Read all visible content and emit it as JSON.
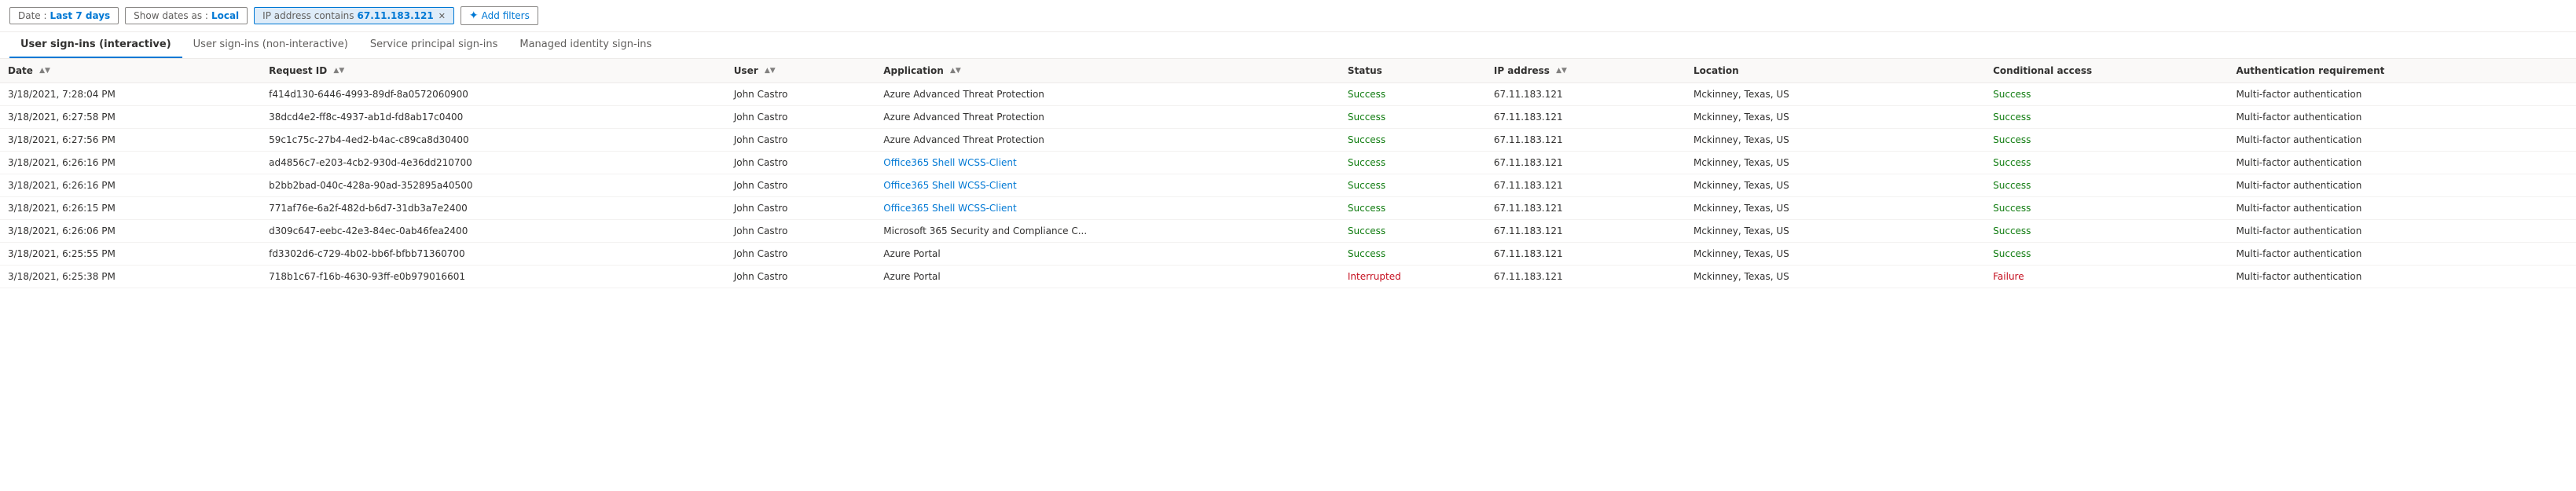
{
  "topbar": {
    "date_label": "Date :",
    "date_value": "Last 7 days",
    "show_dates_label": "Show dates as :",
    "show_dates_value": "Local",
    "ip_filter_label": "IP address contains",
    "ip_filter_value": "67.11.183.121",
    "add_filters_label": "Add filters"
  },
  "tabs": [
    {
      "id": "interactive",
      "label": "User sign-ins (interactive)",
      "active": true
    },
    {
      "id": "noninteractive",
      "label": "User sign-ins (non-interactive)",
      "active": false
    },
    {
      "id": "service",
      "label": "Service principal sign-ins",
      "active": false
    },
    {
      "id": "managed",
      "label": "Managed identity sign-ins",
      "active": false
    }
  ],
  "table": {
    "columns": [
      {
        "id": "date",
        "label": "Date",
        "sortable": true
      },
      {
        "id": "reqid",
        "label": "Request ID",
        "sortable": true
      },
      {
        "id": "user",
        "label": "User",
        "sortable": true
      },
      {
        "id": "app",
        "label": "Application",
        "sortable": true
      },
      {
        "id": "status",
        "label": "Status",
        "sortable": false
      },
      {
        "id": "ip",
        "label": "IP address",
        "sortable": true
      },
      {
        "id": "location",
        "label": "Location",
        "sortable": false
      },
      {
        "id": "ca",
        "label": "Conditional access",
        "sortable": false
      },
      {
        "id": "auth",
        "label": "Authentication requirement",
        "sortable": false
      }
    ],
    "rows": [
      {
        "date": "3/18/2021, 7:28:04 PM",
        "reqid": "f414d130-6446-4993-89df-8a0572060900",
        "user": "John Castro",
        "app": "Azure Advanced Threat Protection",
        "app_link": false,
        "status": "Success",
        "status_type": "success",
        "ip": "67.11.183.121",
        "location": "Mckinney, Texas, US",
        "ca": "Success",
        "auth": "Multi-factor authentication"
      },
      {
        "date": "3/18/2021, 6:27:58 PM",
        "reqid": "38dcd4e2-ff8c-4937-ab1d-fd8ab17c0400",
        "user": "John Castro",
        "app": "Azure Advanced Threat Protection",
        "app_link": false,
        "status": "Success",
        "status_type": "success",
        "ip": "67.11.183.121",
        "location": "Mckinney, Texas, US",
        "ca": "Success",
        "auth": "Multi-factor authentication"
      },
      {
        "date": "3/18/2021, 6:27:56 PM",
        "reqid": "59c1c75c-27b4-4ed2-b4ac-c89ca8d30400",
        "user": "John Castro",
        "app": "Azure Advanced Threat Protection",
        "app_link": false,
        "status": "Success",
        "status_type": "success",
        "ip": "67.11.183.121",
        "location": "Mckinney, Texas, US",
        "ca": "Success",
        "auth": "Multi-factor authentication"
      },
      {
        "date": "3/18/2021, 6:26:16 PM",
        "reqid": "ad4856c7-e203-4cb2-930d-4e36dd210700",
        "user": "John Castro",
        "app": "Office365 Shell WCSS-Client",
        "app_link": true,
        "status": "Success",
        "status_type": "success",
        "ip": "67.11.183.121",
        "location": "Mckinney, Texas, US",
        "ca": "Success",
        "auth": "Multi-factor authentication"
      },
      {
        "date": "3/18/2021, 6:26:16 PM",
        "reqid": "b2bb2bad-040c-428a-90ad-352895a40500",
        "user": "John Castro",
        "app": "Office365 Shell WCSS-Client",
        "app_link": true,
        "status": "Success",
        "status_type": "success",
        "ip": "67.11.183.121",
        "location": "Mckinney, Texas, US",
        "ca": "Success",
        "auth": "Multi-factor authentication"
      },
      {
        "date": "3/18/2021, 6:26:15 PM",
        "reqid": "771af76e-6a2f-482d-b6d7-31db3a7e2400",
        "user": "John Castro",
        "app": "Office365 Shell WCSS-Client",
        "app_link": true,
        "status": "Success",
        "status_type": "success",
        "ip": "67.11.183.121",
        "location": "Mckinney, Texas, US",
        "ca": "Success",
        "auth": "Multi-factor authentication"
      },
      {
        "date": "3/18/2021, 6:26:06 PM",
        "reqid": "d309c647-eebc-42e3-84ec-0ab46fea2400",
        "user": "John Castro",
        "app": "Microsoft 365 Security and Compliance C...",
        "app_link": false,
        "status": "Success",
        "status_type": "success",
        "ip": "67.11.183.121",
        "location": "Mckinney, Texas, US",
        "ca": "Success",
        "auth": "Multi-factor authentication"
      },
      {
        "date": "3/18/2021, 6:25:55 PM",
        "reqid": "fd3302d6-c729-4b02-bb6f-bfbb71360700",
        "user": "John Castro",
        "app": "Azure Portal",
        "app_link": false,
        "status": "Success",
        "status_type": "success",
        "ip": "67.11.183.121",
        "location": "Mckinney, Texas, US",
        "ca": "Success",
        "auth": "Multi-factor authentication"
      },
      {
        "date": "3/18/2021, 6:25:38 PM",
        "reqid": "718b1c67-f16b-4630-93ff-e0b979016601",
        "user": "John Castro",
        "app": "Azure Portal",
        "app_link": false,
        "status": "Interrupted",
        "status_type": "interrupted",
        "ip": "67.11.183.121",
        "location": "Mckinney, Texas, US",
        "ca": "Failure",
        "auth": "Multi-factor authentication"
      }
    ]
  }
}
